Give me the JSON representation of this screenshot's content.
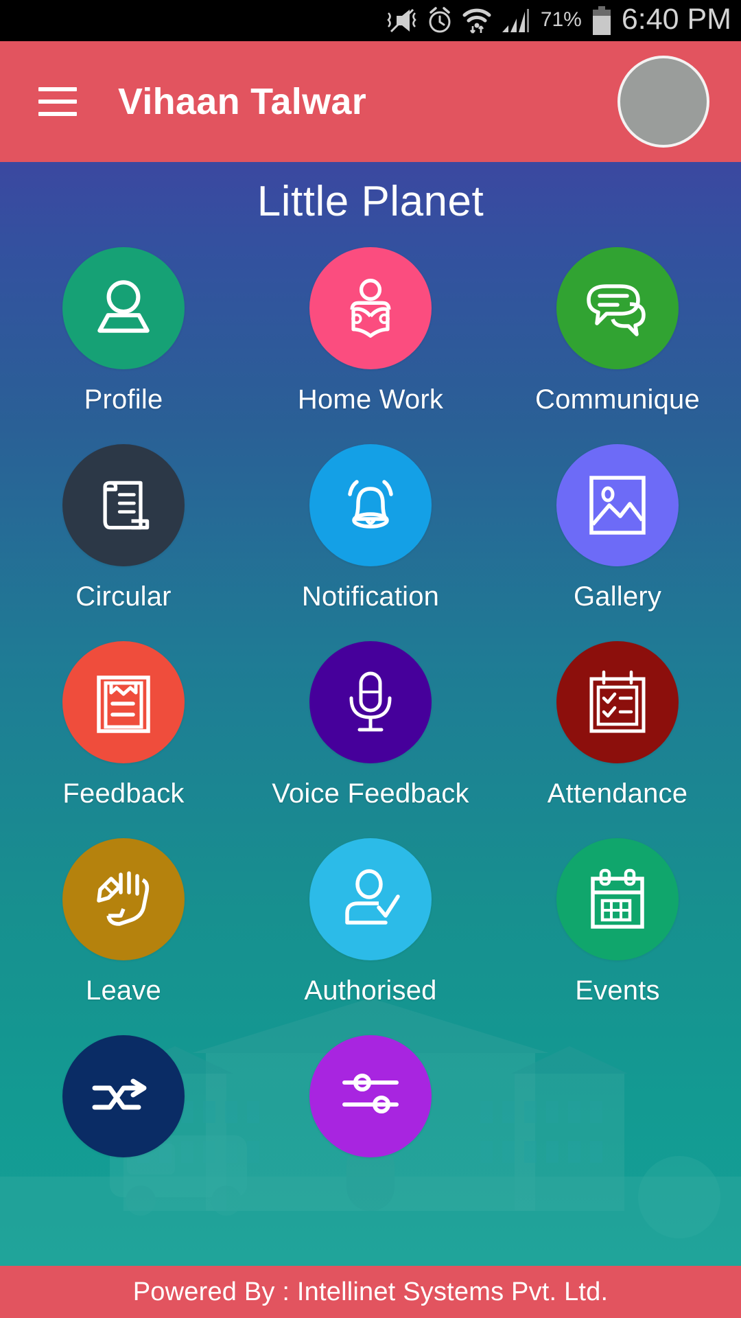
{
  "status_bar": {
    "battery_percent": "71%",
    "time": "6:40 PM",
    "icons": [
      "vibrate-mute-icon",
      "alarm-icon",
      "wifi-icon",
      "signal-icon",
      "battery-icon"
    ]
  },
  "header": {
    "menu_icon": "hamburger-menu-icon",
    "user_name": "Vihaan Talwar",
    "avatar": "user-avatar",
    "background_color": "#e2545f"
  },
  "main": {
    "title": "Little Planet",
    "background_gradient_from": "#3b48a0",
    "background_gradient_to": "#14a096",
    "tiles": [
      {
        "label": "Profile",
        "icon": "user-profile-icon",
        "color": "#16a175"
      },
      {
        "label": "Home Work",
        "icon": "reading-person-icon",
        "color": "#fb4d7f"
      },
      {
        "label": "Communique",
        "icon": "chat-bubbles-icon",
        "color": "#31a332"
      },
      {
        "label": "Circular",
        "icon": "scroll-document-icon",
        "color": "#2c3847"
      },
      {
        "label": "Notification",
        "icon": "bell-icon",
        "color": "#14a0e6"
      },
      {
        "label": "Gallery",
        "icon": "image-picture-icon",
        "color": "#6d6bf7"
      },
      {
        "label": "Feedback",
        "icon": "clipboard-icon",
        "color": "#ef4d3c"
      },
      {
        "label": "Voice Feedback",
        "icon": "microphone-icon",
        "color": "#46009b"
      },
      {
        "label": "Attendance",
        "icon": "calendar-check-icon",
        "color": "#8c0f0c"
      },
      {
        "label": "Leave",
        "icon": "hand-writing-icon",
        "color": "#b5820d"
      },
      {
        "label": "Authorised",
        "icon": "user-check-icon",
        "color": "#2cbbe8"
      },
      {
        "label": "Events",
        "icon": "calendar-icon",
        "color": "#10a66c"
      },
      {
        "label": "",
        "icon": "transfer-arrows-icon",
        "color": "#0a2c65"
      },
      {
        "label": "",
        "icon": "settings-sliders-icon",
        "color": "#a825e0"
      }
    ]
  },
  "footer": {
    "text": "Powered By : Intellinet Systems Pvt. Ltd.",
    "background_color": "#e2545f"
  }
}
